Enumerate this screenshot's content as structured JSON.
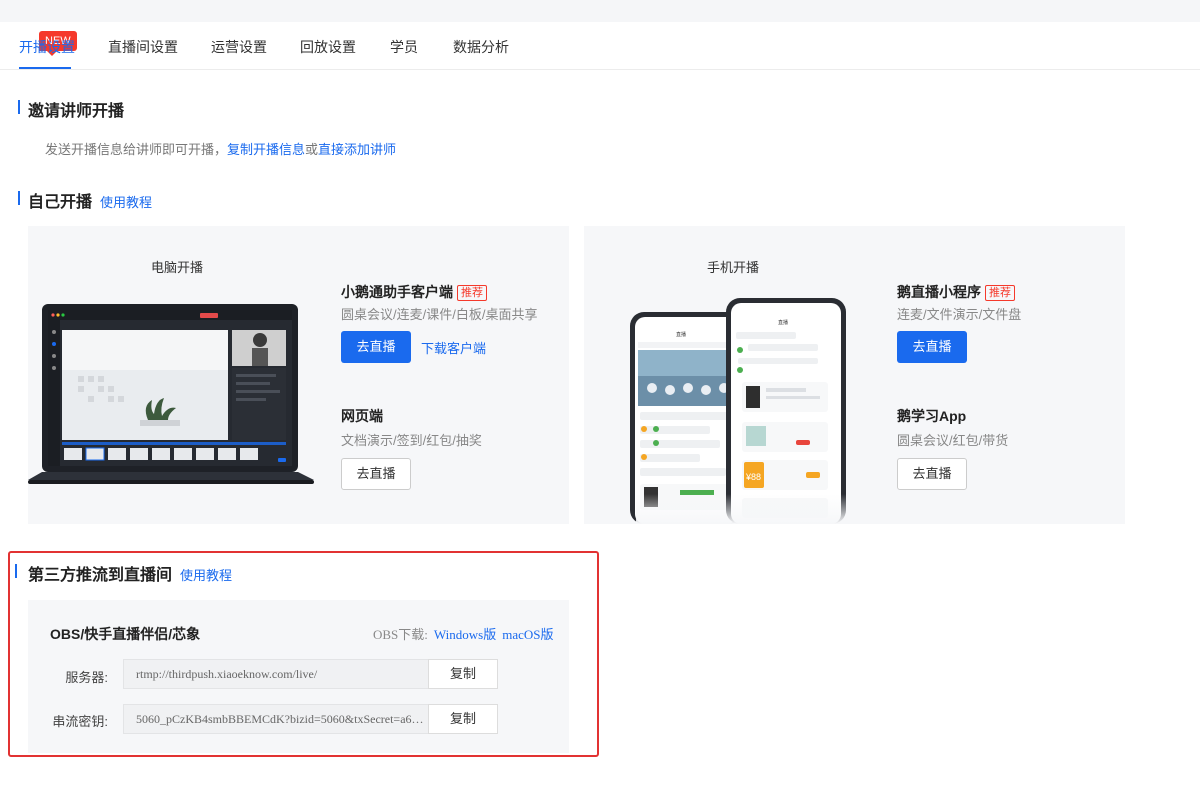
{
  "tabs": [
    {
      "label": "开播设置"
    },
    {
      "label": "直播间设置"
    },
    {
      "label": "运营设置"
    },
    {
      "label": "回放设置"
    },
    {
      "label": "学员"
    },
    {
      "label": "数据分析"
    }
  ],
  "new_badge": "NEW",
  "invite": {
    "title": "邀请讲师开播",
    "desc_prefix": "发送开播信息给讲师即可开播，",
    "link_copy": "复制开播信息",
    "or": "或",
    "link_add": "直接添加讲师"
  },
  "self": {
    "title": "自己开播",
    "tutorial": "使用教程",
    "pc": {
      "head": "电脑开播",
      "opt1_title": "小鹅通助手客户端",
      "opt1_tag": "推荐",
      "opt1_desc": "圆桌会议/连麦/课件/白板/桌面共享",
      "opt1_btn": "去直播",
      "opt1_link": "下载客户端",
      "opt2_title": "网页端",
      "opt2_desc": "文档演示/签到/红包/抽奖",
      "opt2_btn": "去直播"
    },
    "mobile": {
      "head": "手机开播",
      "opt1_title": "鹅直播小程序",
      "opt1_tag": "推荐",
      "opt1_desc": "连麦/文件演示/文件盘",
      "opt1_btn": "去直播",
      "opt2_title": "鹅学习App",
      "opt2_desc": "圆桌会议/红包/带货",
      "opt2_btn": "去直播"
    }
  },
  "third": {
    "title": "第三方推流到直播间",
    "tutorial": "使用教程",
    "obs_title": "OBS/快手直播伴侣/芯象",
    "obs_dl_label": "OBS下载:",
    "obs_windows": "Windows版",
    "obs_mac": "macOS版",
    "server_label": "服务器:",
    "server_value": "rtmp://thirdpush.xiaoeknow.com/live/",
    "key_label": "串流密钥:",
    "key_value": "5060_pCzKB4smbBBEMCdK?bizid=5060&txSecret=a61f...",
    "copy": "复制"
  },
  "phone_mock": {
    "title": "直播",
    "price": "¥88"
  },
  "colors": {
    "accent": "#1a6aee",
    "danger": "#f5392b",
    "card": "#f6f7f9"
  }
}
